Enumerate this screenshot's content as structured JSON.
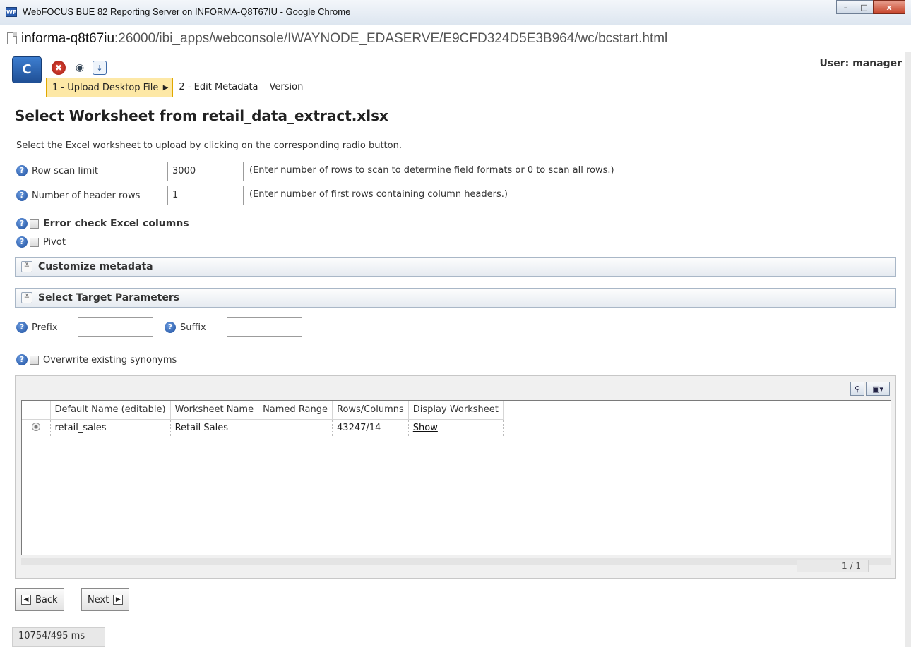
{
  "window": {
    "title": "WebFOCUS BUE 82 Reporting Server on INFORMA-Q8T67IU - Google Chrome",
    "app_icon": "WF",
    "minimize": "–",
    "maximize": "□",
    "close": "x"
  },
  "address": {
    "host": "informa-q8t67iu",
    "path": ":26000/ibi_apps/webconsole/IWAYNODE_EDASERVE/E9CFD324D5E3B964/wc/bcstart.html"
  },
  "toolbar": {
    "logo": "C",
    "icons": [
      "stop-icon",
      "eye-icon",
      "download-icon"
    ],
    "user_label": "User: manager"
  },
  "tabs": [
    {
      "label": "1 - Upload Desktop File",
      "active": true
    },
    {
      "label": "2 - Edit Metadata",
      "active": false
    },
    {
      "label": "Version",
      "active": false
    }
  ],
  "page": {
    "title": "Select Worksheet from retail_data_extract.xlsx",
    "instruction": "Select the Excel worksheet to upload by clicking on the corresponding radio button."
  },
  "form": {
    "row_scan_limit": {
      "label": "Row scan limit",
      "value": "3000",
      "hint": "(Enter number of rows to scan to determine field formats or 0 to scan all rows.)"
    },
    "header_rows": {
      "label": "Number of header rows",
      "value": "1",
      "hint": "(Enter number of first rows containing column headers.)"
    },
    "error_check": {
      "label": "Error check Excel columns",
      "checked": false
    },
    "pivot": {
      "label": "Pivot",
      "checked": false
    },
    "prefix": {
      "label": "Prefix",
      "value": ""
    },
    "suffix": {
      "label": "Suffix",
      "value": ""
    },
    "overwrite": {
      "label": "Overwrite existing synonyms",
      "checked": false
    }
  },
  "sections": {
    "customize": "Customize metadata",
    "target": "Select Target Parameters"
  },
  "grid": {
    "columns": [
      "",
      "Default Name (editable)",
      "Worksheet Name",
      "Named Range",
      "Rows/Columns",
      "Display Worksheet"
    ],
    "rows": [
      {
        "default_name": "retail_sales",
        "worksheet": "Retail Sales",
        "named_range": "",
        "rows_cols": "43247/14",
        "display": "Show"
      }
    ],
    "pager": "1 / 1"
  },
  "buttons": {
    "back": "Back",
    "next": "Next"
  },
  "status": "10754/495 ms"
}
